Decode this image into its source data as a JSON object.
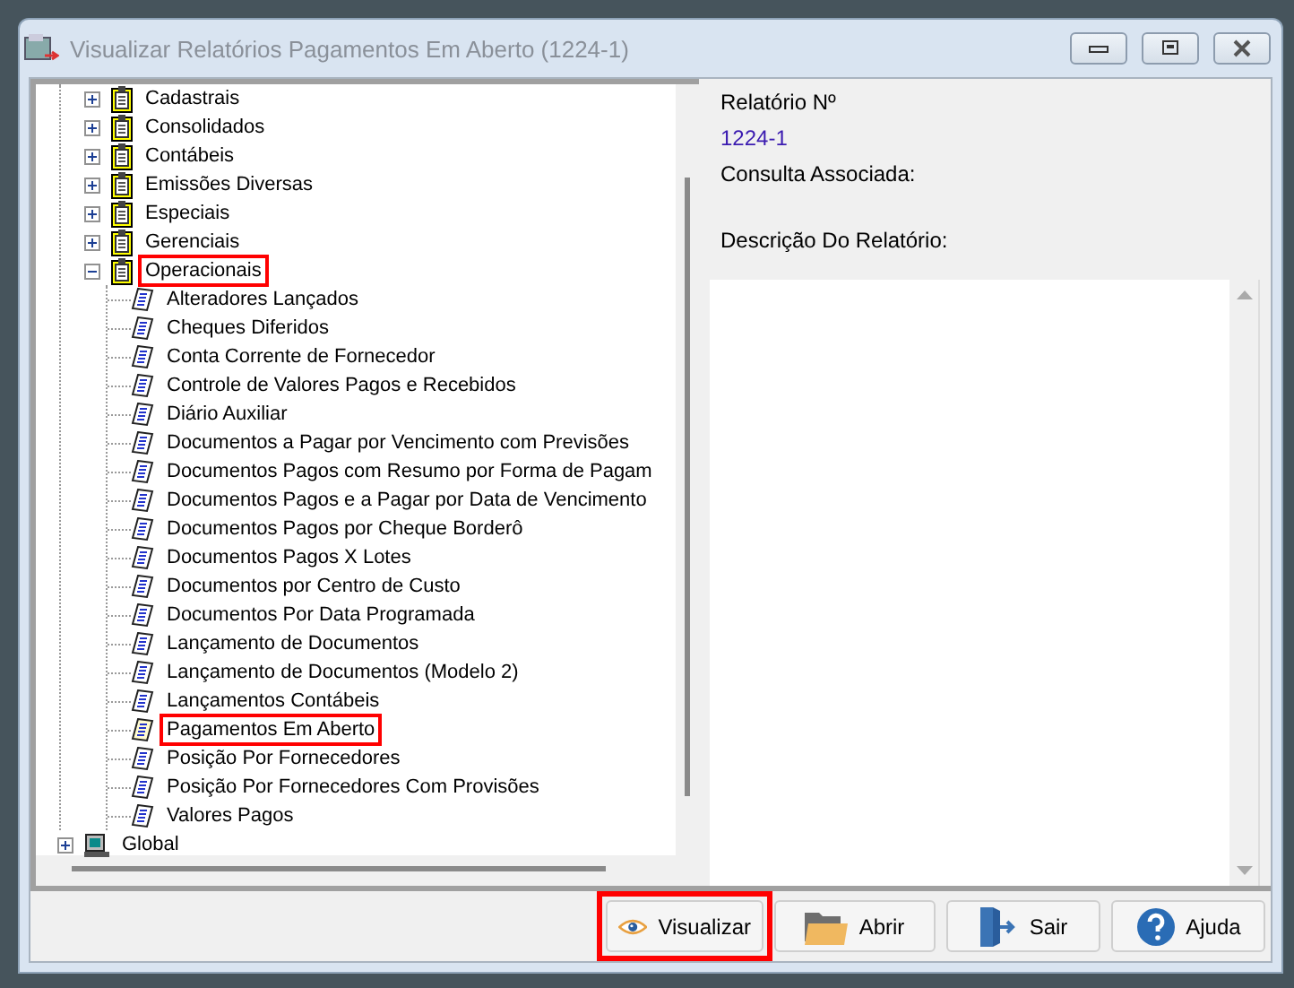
{
  "window": {
    "title": "Visualizar Relatórios Pagamentos Em Aberto (1224-1)"
  },
  "tree": {
    "items": [
      {
        "kind": "group",
        "children": [
          {
            "kind": "folder",
            "label": "Cadastrais",
            "expanded": false,
            "highlighted": false
          },
          {
            "kind": "folder",
            "label": "Consolidados",
            "expanded": false,
            "highlighted": false
          },
          {
            "kind": "folder",
            "label": "Contábeis",
            "expanded": false,
            "highlighted": false
          },
          {
            "kind": "folder",
            "label": "Emissões Diversas",
            "expanded": false,
            "highlighted": false
          },
          {
            "kind": "folder",
            "label": "Especiais",
            "expanded": false,
            "highlighted": false
          },
          {
            "kind": "folder",
            "label": "Gerenciais",
            "expanded": false,
            "highlighted": false
          },
          {
            "kind": "folder",
            "label": "Operacionais",
            "expanded": true,
            "highlighted": true,
            "children": [
              {
                "kind": "report",
                "label": "Alteradores Lançados",
                "highlighted": false
              },
              {
                "kind": "report",
                "label": "Cheques Diferidos",
                "highlighted": false
              },
              {
                "kind": "report",
                "label": "Conta Corrente de Fornecedor",
                "highlighted": false
              },
              {
                "kind": "report",
                "label": "Controle de Valores Pagos e Recebidos",
                "highlighted": false
              },
              {
                "kind": "report",
                "label": "Diário Auxiliar",
                "highlighted": false
              },
              {
                "kind": "report",
                "label": "Documentos a Pagar por Vencimento com Previsões",
                "highlighted": false
              },
              {
                "kind": "report",
                "label": "Documentos Pagos com Resumo por Forma de Pagam",
                "highlighted": false
              },
              {
                "kind": "report",
                "label": "Documentos Pagos e a Pagar por Data de Vencimento",
                "highlighted": false
              },
              {
                "kind": "report",
                "label": "Documentos Pagos por Cheque Borderô",
                "highlighted": false
              },
              {
                "kind": "report",
                "label": "Documentos Pagos X Lotes",
                "highlighted": false
              },
              {
                "kind": "report",
                "label": "Documentos por Centro de Custo",
                "highlighted": false
              },
              {
                "kind": "report",
                "label": "Documentos Por Data Programada",
                "highlighted": false
              },
              {
                "kind": "report",
                "label": "Lançamento de Documentos",
                "highlighted": false
              },
              {
                "kind": "report",
                "label": "Lançamento de Documentos (Modelo 2)",
                "highlighted": false
              },
              {
                "kind": "report",
                "label": "Lançamentos Contábeis",
                "highlighted": false
              },
              {
                "kind": "report",
                "label": "Pagamentos Em Aberto",
                "highlighted": true
              },
              {
                "kind": "report",
                "label": "Posição Por Fornecedores",
                "highlighted": false
              },
              {
                "kind": "report",
                "label": "Posição Por Fornecedores Com Provisões",
                "highlighted": false
              },
              {
                "kind": "report",
                "label": "Valores Pagos",
                "highlighted": false
              }
            ]
          }
        ]
      },
      {
        "kind": "computer",
        "label": "Global",
        "expanded": false,
        "highlighted": false
      }
    ]
  },
  "details": {
    "number_label": "Relatório Nº",
    "number_value": "1224-1",
    "query_label": "Consulta Associada:",
    "description_label": "Descrição Do Relatório:"
  },
  "buttons": [
    {
      "kind": "view",
      "label": "Visualizar",
      "highlighted": true
    },
    {
      "kind": "open",
      "label": "Abrir",
      "highlighted": false
    },
    {
      "kind": "exit",
      "label": "Sair",
      "highlighted": false
    },
    {
      "kind": "help",
      "label": "Ajuda",
      "highlighted": false
    }
  ]
}
